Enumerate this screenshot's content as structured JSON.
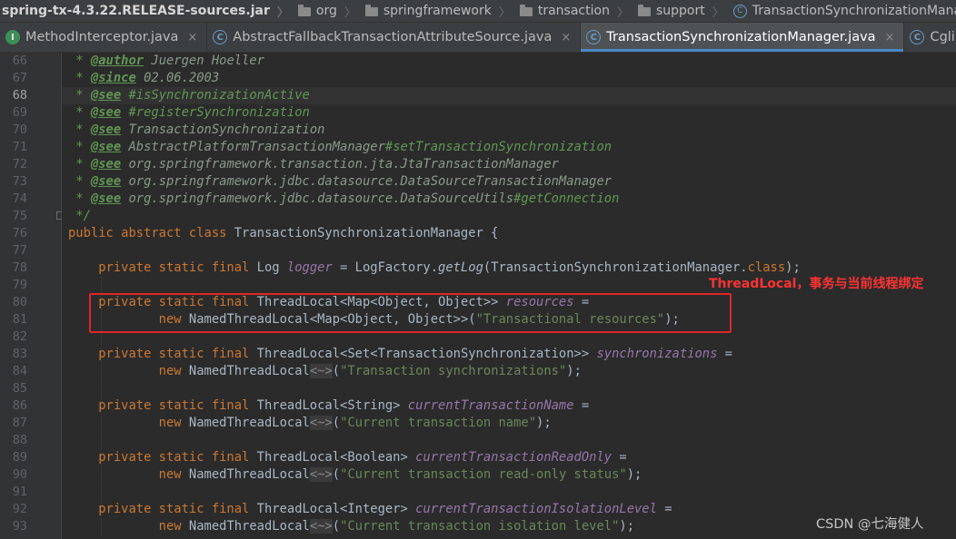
{
  "breadcrumb": [
    {
      "label": "spring-tx-4.3.22.RELEASE-sources.jar",
      "icon": "jar"
    },
    {
      "label": "org",
      "icon": "folder-icon"
    },
    {
      "label": "springframework",
      "icon": "folder-icon"
    },
    {
      "label": "transaction",
      "icon": "folder-icon"
    },
    {
      "label": "support",
      "icon": "folder-icon"
    },
    {
      "label": "TransactionSynchronizationManager",
      "icon": "class-icon"
    }
  ],
  "tabs": [
    {
      "label": "MethodInterceptor.java",
      "close": "×",
      "icon": "interface-icon",
      "icon_letter": "I"
    },
    {
      "label": "AbstractFallbackTransactionAttributeSource.java",
      "close": "×",
      "icon": "class-icon",
      "icon_letter": "C"
    },
    {
      "label": "TransactionSynchronizationManager.java",
      "close": "×",
      "icon": "class-icon",
      "icon_letter": "C",
      "active": true
    },
    {
      "label": "CglibAopPro",
      "icon": "class-icon",
      "icon_letter": "C"
    }
  ],
  "line_numbers": [
    "66",
    "67",
    "68",
    "69",
    "70",
    "71",
    "72",
    "73",
    "74",
    "75",
    "76",
    "77",
    "78",
    "79",
    "80",
    "81",
    "82",
    "83",
    "84",
    "85",
    "86",
    "87",
    "88",
    "89",
    "90",
    "91",
    "92",
    "93"
  ],
  "current_line": "68",
  "code": {
    "l66": {
      "star": " * ",
      "tag": "@author",
      "rest": " Juergen Hoeller"
    },
    "l67": {
      "star": " * ",
      "tag": "@since",
      "rest": " 02.06.2003"
    },
    "l68": {
      "star": " * ",
      "tag": "@see",
      "rest": " #isSynchronizationActive"
    },
    "l69": {
      "star": " * ",
      "tag": "@see",
      "rest": " #registerSynchronization"
    },
    "l70": {
      "star": " * ",
      "tag": "@see",
      "rest": " TransactionSynchronization"
    },
    "l71": {
      "star": " * ",
      "tag": "@see",
      "rest_a": " AbstractPlatformTransactionManager",
      "rest_b": "#setTransactionSynchronization"
    },
    "l72": {
      "star": " * ",
      "tag": "@see",
      "rest": " org.springframework.transaction.jta.JtaTransactionManager"
    },
    "l73": {
      "star": " * ",
      "tag": "@see",
      "rest": " org.springframework.jdbc.datasource.DataSourceTransactionManager"
    },
    "l74": {
      "star": " * ",
      "tag": "@see",
      "rest_a": " org.springframework.jdbc.datasource.DataSourceUtils",
      "rest_b": "#getConnection"
    },
    "l75": {
      "text": " */"
    },
    "l76": {
      "kw": "public abstract class",
      "rest": " TransactionSynchronizationManager {"
    },
    "l78": {
      "kw": "    private static final",
      "a": " Log ",
      "field": "logger",
      "b": " = LogFactory.",
      "method": "getLog",
      "c": "(TransactionSynchronizationManager.",
      "kw2": "class",
      "d": ");"
    },
    "l80": {
      "kw": "    private static final",
      "a": " ThreadLocal<Map<Object, Object>> ",
      "field": "resources",
      "b": " ="
    },
    "l81": {
      "kw": "            new",
      "a": " NamedThreadLocal<Map<Object, Object>>(",
      "str": "\"Transactional resources\"",
      "b": ");"
    },
    "l83": {
      "kw": "    private static final",
      "a": " ThreadLocal<Set<TransactionSynchronization>> ",
      "field": "synchronizations",
      "b": " ="
    },
    "l84": {
      "kw": "            new",
      "a": " NamedThreadLocal",
      "fold": "<~>",
      "b": "(",
      "str": "\"Transaction synchronizations\"",
      "c": ");"
    },
    "l86": {
      "kw": "    private static final",
      "a": " ThreadLocal<String> ",
      "field": "currentTransactionName",
      "b": " ="
    },
    "l87": {
      "kw": "            new",
      "a": " NamedThreadLocal",
      "fold": "<~>",
      "b": "(",
      "str": "\"Current transaction name\"",
      "c": ");"
    },
    "l89": {
      "kw": "    private static final",
      "a": " ThreadLocal<Boolean> ",
      "field": "currentTransactionReadOnly",
      "b": " ="
    },
    "l90": {
      "kw": "            new",
      "a": " NamedThreadLocal",
      "fold": "<~>",
      "b": "(",
      "str": "\"Current transaction read-only status\"",
      "c": ");"
    },
    "l92": {
      "kw": "    private static final",
      "a": " ThreadLocal<Integer> ",
      "field": "currentTransactionIsolationLevel",
      "b": " ="
    },
    "l93": {
      "kw": "            new",
      "a": " NamedThreadLocal",
      "fold": "<~>",
      "b": "(",
      "str": "\"Current transaction isolation level\"",
      "c": ");"
    }
  },
  "annotation": "ThreadLocal，事务与当前线程绑定",
  "watermark": "CSDN @七海健人",
  "colors": {
    "background": "#2b2b2b",
    "keyword": "#cc7832",
    "field": "#9876aa",
    "string": "#6a8759",
    "javadoc": "#629755",
    "highlight_box": "#e0262a",
    "annotation_text": "#ff3333",
    "active_tab_underline": "#4a88c7"
  }
}
